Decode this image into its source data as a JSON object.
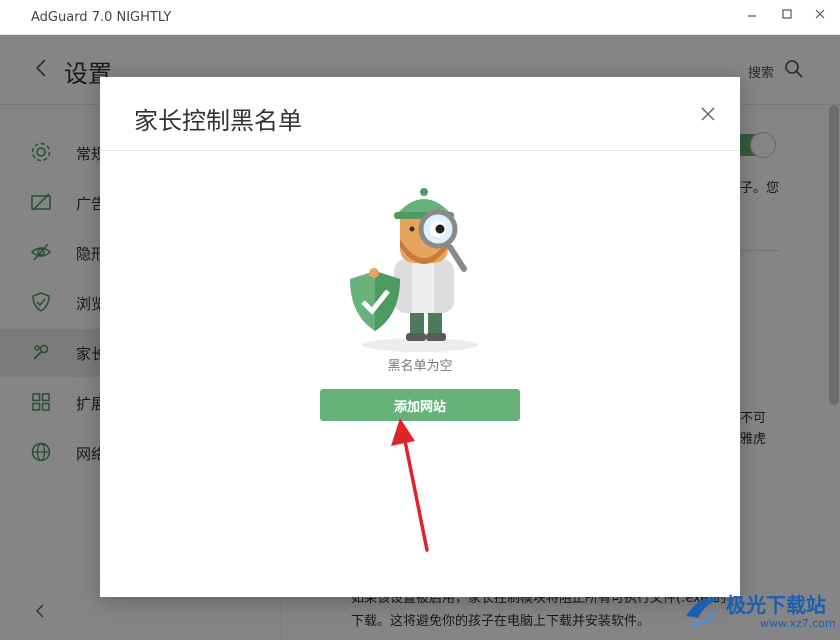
{
  "window": {
    "title": "AdGuard 7.0 NIGHTLY",
    "minimize_icon": "minimize-icon",
    "maximize_icon": "maximize-icon",
    "close_icon": "close-icon"
  },
  "header": {
    "title": "设置",
    "search_label": "搜索"
  },
  "sidebar": {
    "items": [
      {
        "label": "常规",
        "icon": "gear-icon"
      },
      {
        "label": "广告",
        "icon": "ad-block-icon"
      },
      {
        "label": "隐形",
        "icon": "stealth-eye-icon"
      },
      {
        "label": "浏览",
        "icon": "shield-icon"
      },
      {
        "label": "家长",
        "icon": "parental-control-icon"
      },
      {
        "label": "扩展",
        "icon": "extensions-icon"
      },
      {
        "label": "网络",
        "icon": "globe-icon"
      }
    ],
    "active_index": 4
  },
  "background_text": {
    "line1": "子。您",
    "line2": "不可",
    "line3": "雅虎",
    "bottom1": "如果该设置被启用，家长控制模块将阻止所有可执行文件(.exe)的",
    "bottom2": "下载。这将避免你的孩子在电脑上下载并安装软件。"
  },
  "modal": {
    "title": "家长控制黑名单",
    "empty_text": "黑名单为空",
    "add_button": "添加网站"
  },
  "colors": {
    "accent": "#67b279",
    "arrow": "#e0242b",
    "watermark": "#1b5fb4"
  },
  "watermark": {
    "text": "极光下载站",
    "url": "www.xz7.com"
  }
}
